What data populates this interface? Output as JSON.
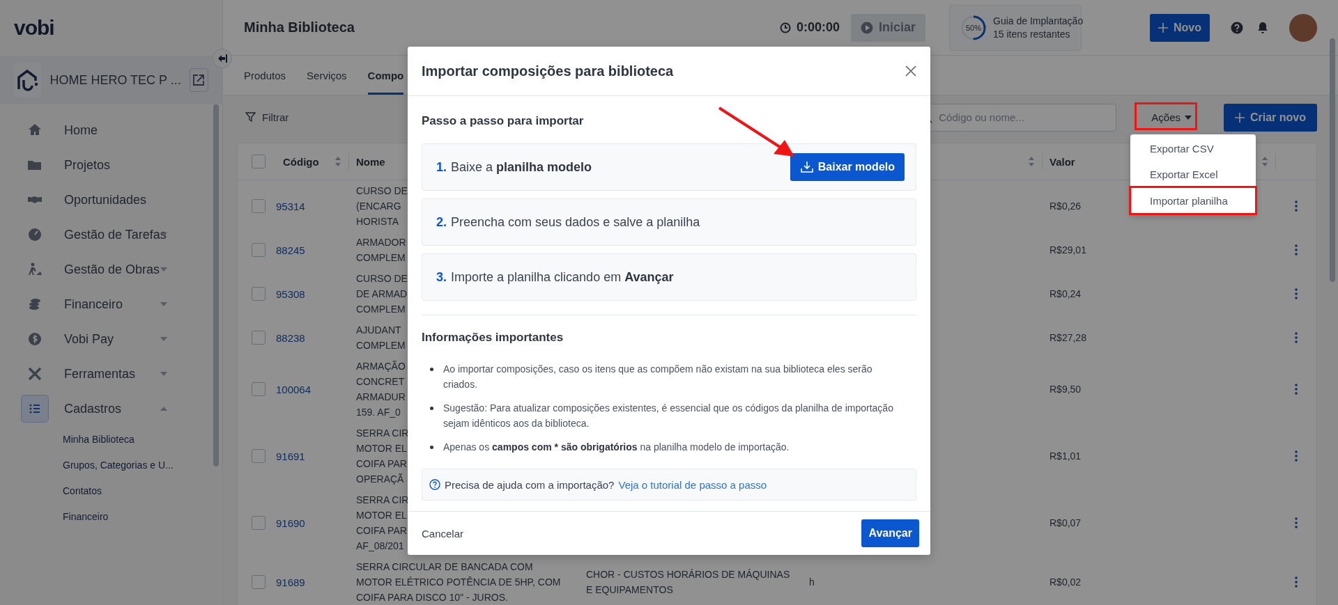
{
  "sidebar": {
    "logo": "vobi",
    "company": "HOME HERO TEC P ...",
    "items": [
      {
        "label": "Home",
        "kind": "link",
        "selected": false
      },
      {
        "label": "Projetos",
        "kind": "link",
        "selected": false
      },
      {
        "label": "Oportunidades",
        "kind": "link",
        "selected": false
      },
      {
        "label": "Gestão de Tarefas",
        "kind": "group",
        "selected": false,
        "expanded": false
      },
      {
        "label": "Gestão de Obras",
        "kind": "group",
        "selected": false,
        "expanded": false
      },
      {
        "label": "Financeiro",
        "kind": "group",
        "selected": false,
        "expanded": false
      },
      {
        "label": "Vobi Pay",
        "kind": "group",
        "selected": false,
        "expanded": false
      },
      {
        "label": "Ferramentas",
        "kind": "group",
        "selected": false,
        "expanded": false
      },
      {
        "label": "Cadastros",
        "kind": "group",
        "selected": true,
        "expanded": true,
        "children": [
          {
            "label": "Minha Biblioteca",
            "selected": false
          },
          {
            "label": "Grupos, Categorias e U...",
            "selected": false
          },
          {
            "label": "Contatos",
            "selected": false
          },
          {
            "label": "Financeiro",
            "selected": false
          }
        ]
      }
    ]
  },
  "header": {
    "title": "Minha Biblioteca",
    "timer": "0:00:00",
    "start_button": {
      "label": "Iniciar",
      "disabled": true
    },
    "guide": {
      "percent": "50%",
      "level": 0.5,
      "title": "Guia de Implantação",
      "subtitle": "15 itens restantes"
    },
    "new_button": "Novo"
  },
  "tabs": [
    {
      "label": "Produtos",
      "selected": false
    },
    {
      "label": "Serviços",
      "selected": false
    },
    {
      "label": "Compo",
      "selected": true
    }
  ],
  "toolbar": {
    "filter": "Filtrar",
    "search_placeholder": "Código ou nome...",
    "actions": {
      "label": "Ações",
      "annotated": true
    },
    "create_button": "Criar novo"
  },
  "actions_menu": [
    {
      "label": "Exportar CSV",
      "annotated": false
    },
    {
      "label": "Exportar Excel",
      "annotated": false
    },
    {
      "label": "Importar planilha",
      "annotated": true
    }
  ],
  "table": {
    "select_all_checked": false,
    "columns": [
      {
        "label": "Código",
        "sortable": true
      },
      {
        "label": "Nome"
      },
      {
        "sortable": true
      },
      {
        "label": "Valor",
        "sortable": true
      }
    ],
    "rows": [
      {
        "checked": false,
        "code": "95314",
        "name": "CURSO DE\n(ENCARG\nHORISTA",
        "value": "R$0,26"
      },
      {
        "checked": false,
        "code": "88245",
        "name": "ARMADOR\nCOMPLEM",
        "value": "R$29,01"
      },
      {
        "checked": false,
        "code": "95308",
        "name": "CURSO DE\nDE ARMAD\nCOMPLEM",
        "value": "R$0,24"
      },
      {
        "checked": false,
        "code": "88238",
        "name": "AJUDANT\nCOMPLEM",
        "value": "R$27,28"
      },
      {
        "checked": false,
        "code": "100064",
        "name": "ARMAÇÃO\nCONCRET\nARMADUR\n159. AF_0",
        "value": "R$9,50"
      },
      {
        "checked": false,
        "code": "91691",
        "name": "SERRA CIR\nMOTOR EL\nCOIFA PAR\nOPERAÇÃ",
        "value": "R$1,01"
      },
      {
        "checked": false,
        "code": "91690",
        "name": "SERRA CIR\nMOTOR EL\nCOIFA PAR\nAF_08/201",
        "value": "R$0,07"
      },
      {
        "checked": false,
        "code": "91689",
        "name": "SERRA CIRCULAR DE BANCADA COM\nMOTOR ELÉTRICO POTÊNCIA DE 5HP, COM\nCOIFA PARA DISCO 10\" - JUROS.",
        "group": "CHOR - CUSTOS HORÁRIOS DE MÁQUINAS\nE EQUIPAMENTOS",
        "unit": "h",
        "value": "R$0,02"
      }
    ]
  },
  "modal": {
    "title": "Importar composições para biblioteca",
    "steps_title": "Passo a passo para importar",
    "steps": [
      {
        "number": "1.",
        "text": "Baixe a **planilha modelo**",
        "button": "Baixar modelo",
        "annotated": true
      },
      {
        "number": "2.",
        "text": "Preencha com seus dados e salve a planilha"
      },
      {
        "number": "3.",
        "text": "Importe a planilha clicando em **Avançar**"
      }
    ],
    "info_title": "Informações importantes",
    "bullets": [
      "Ao importar composições, caso os itens que as compõem não existam na sua biblioteca eles serão criados.",
      "Sugestão: Para atualizar composições existentes, é essencial que os códigos da planilha de importação sejam idênticos aos da biblioteca.",
      "Apenas os **campos com * são obrigatórios** na planilha modelo de importação."
    ],
    "help_text": "Precisa de ajuda com a importação?",
    "help_link": "Veja o tutorial de passo a passo",
    "cancel": "Cancelar",
    "next": "Avançar"
  }
}
